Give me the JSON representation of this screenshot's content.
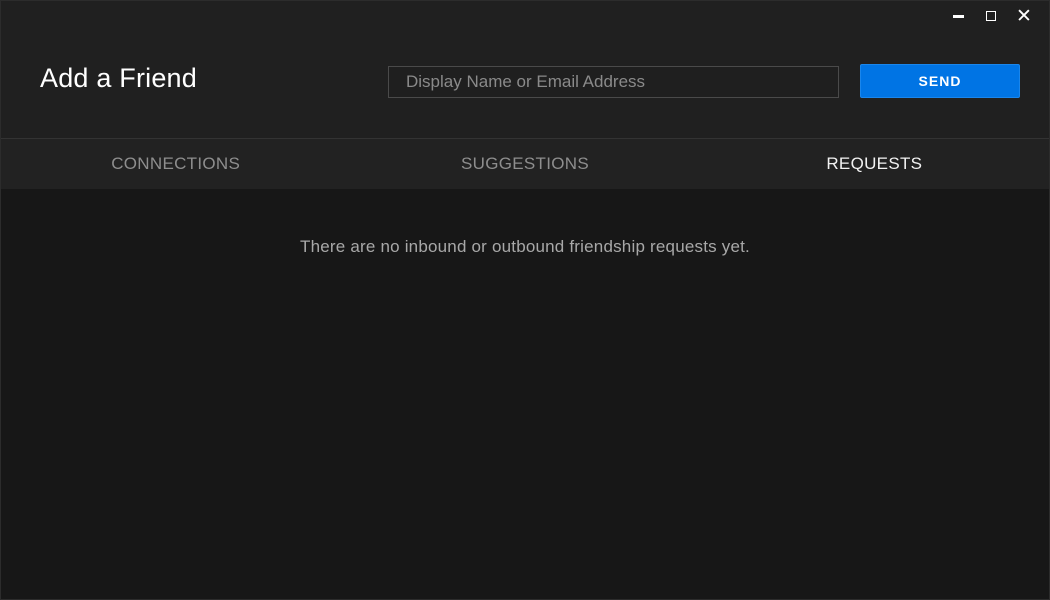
{
  "window": {
    "controls": {
      "minimize_icon": "minimize-icon",
      "maximize_icon": "maximize-icon",
      "close_icon": "close-icon",
      "close_glyph": "✕"
    }
  },
  "header": {
    "title": "Add a Friend",
    "search": {
      "placeholder": "Display Name or Email Address",
      "value": ""
    },
    "send_label": "SEND"
  },
  "tabs": [
    {
      "label": "CONNECTIONS",
      "active": false
    },
    {
      "label": "SUGGESTIONS",
      "active": false
    },
    {
      "label": "REQUESTS",
      "active": true
    }
  ],
  "content": {
    "empty_message": "There are no inbound or outbound friendship requests yet."
  },
  "colors": {
    "accent": "#0074e4",
    "header_bg": "#202020",
    "tabs_bg": "#222222",
    "content_bg": "#171717",
    "active_tab_text": "#f2f2f2",
    "inactive_tab_text": "#8e8e8e"
  }
}
